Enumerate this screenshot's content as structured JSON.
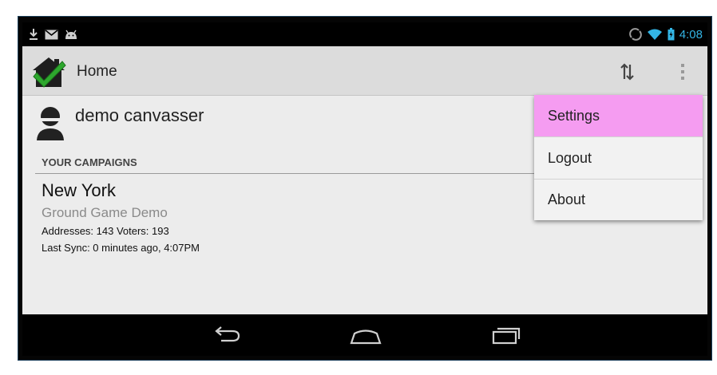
{
  "status_bar": {
    "time": "4:08",
    "left_icons": [
      "download-icon",
      "gmail-icon",
      "android-debug-icon"
    ],
    "right_icons": [
      "sync-status-icon",
      "wifi-icon",
      "battery-icon"
    ],
    "accent_color": "#33b5e5"
  },
  "action_bar": {
    "title": "Home",
    "logo_icon": "house-checkmark-logo-icon",
    "actions": [
      "sync-updown-icon",
      "overflow-menu-icon"
    ]
  },
  "user": {
    "name": "demo canvasser",
    "icon": "person-avatar-icon"
  },
  "campaigns": {
    "header": "YOUR CAMPAIGNS",
    "items": [
      {
        "name": "New York",
        "subtitle": "Ground Game Demo",
        "stats": "Addresses: 143 Voters: 193",
        "last_sync": "Last Sync: 0 minutes ago, 4:07PM"
      }
    ]
  },
  "overflow_menu": {
    "items": [
      {
        "label": "Settings",
        "selected": true
      },
      {
        "label": "Logout",
        "selected": false
      },
      {
        "label": "About",
        "selected": false
      }
    ],
    "highlight_color": "#f59cf1"
  },
  "nav_bar": {
    "buttons": [
      "back-icon",
      "home-icon",
      "recent-apps-icon"
    ]
  }
}
